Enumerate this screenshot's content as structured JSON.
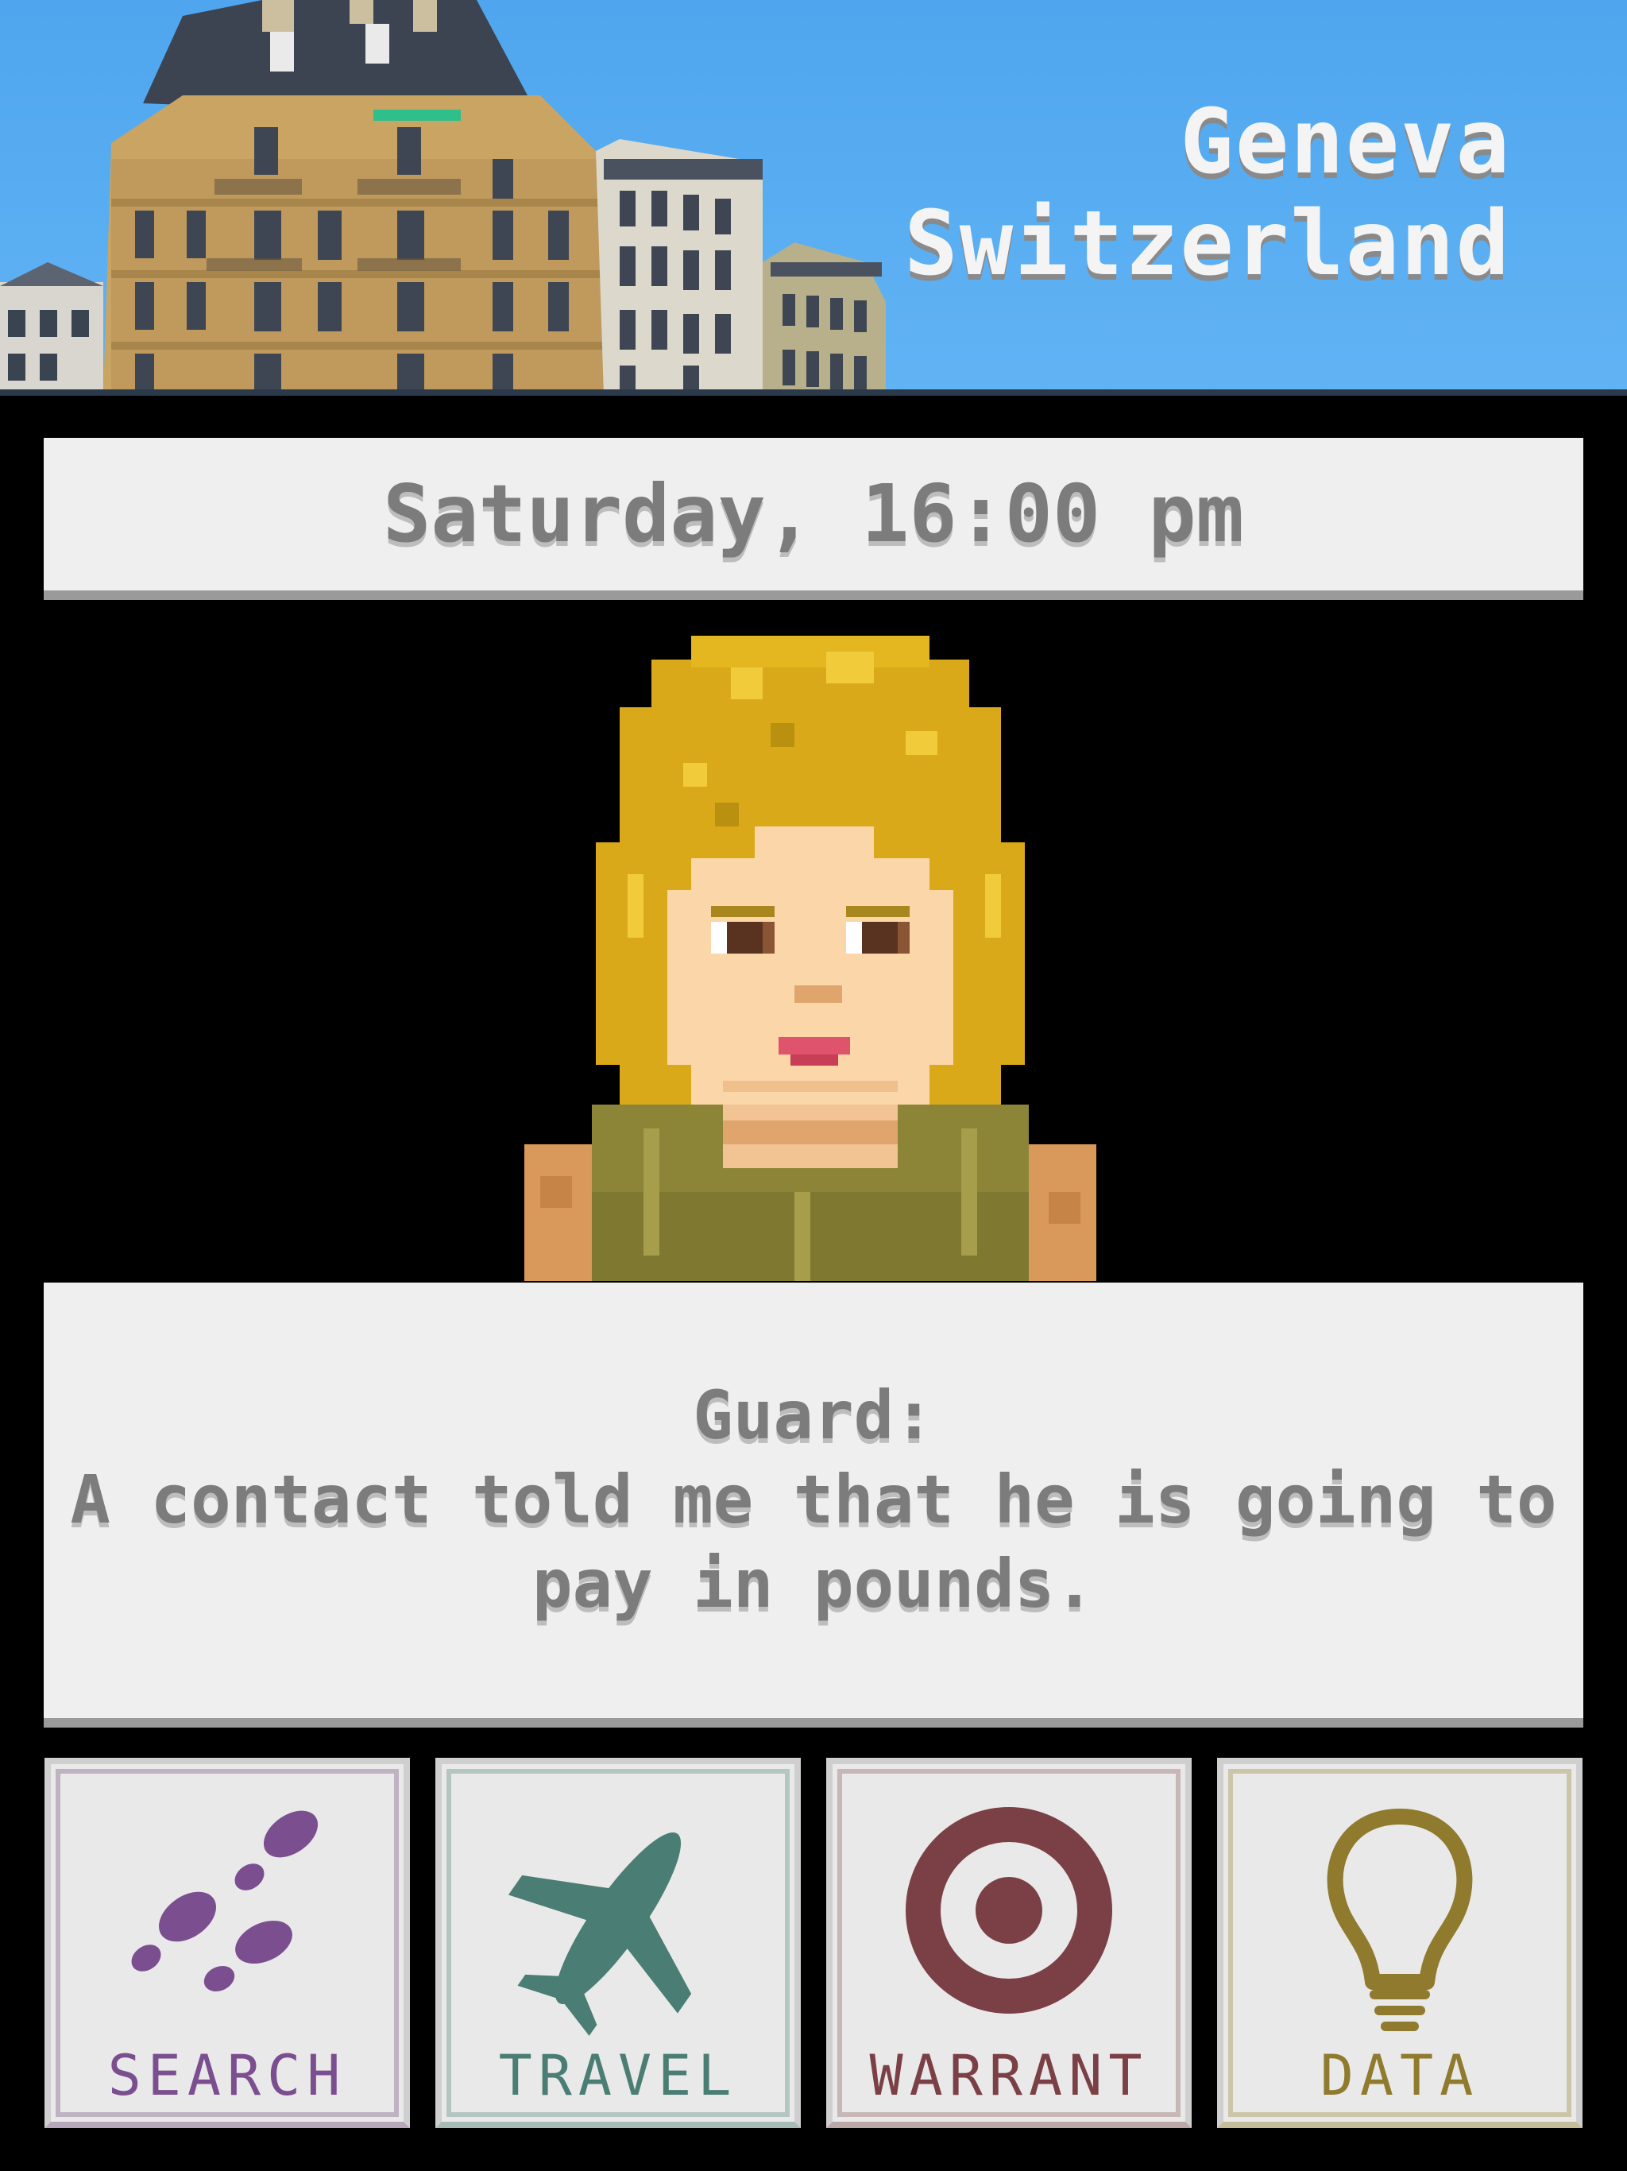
{
  "location": {
    "city": "Geneva",
    "country": "Switzerland"
  },
  "time": {
    "label": "Saturday, 16:00 pm"
  },
  "dialog": {
    "speaker": "Guard:",
    "line1": "A contact told me that he is going to",
    "line2": "pay in pounds."
  },
  "actions": {
    "search": {
      "label": "SEARCH",
      "icon": "footsteps-icon",
      "color": "#7b4f8f"
    },
    "travel": {
      "label": "TRAVEL",
      "icon": "airplane-icon",
      "color": "#4a7d73"
    },
    "warrant": {
      "label": "WARRANT",
      "icon": "target-icon",
      "color": "#7b4045"
    },
    "data": {
      "label": "DATA",
      "icon": "lightbulb-icon",
      "color": "#8f7a2e"
    }
  },
  "colors": {
    "sky": "#5aaef2",
    "panel": "#efefef",
    "panel_text": "#7c7c7c",
    "background": "#000000"
  }
}
